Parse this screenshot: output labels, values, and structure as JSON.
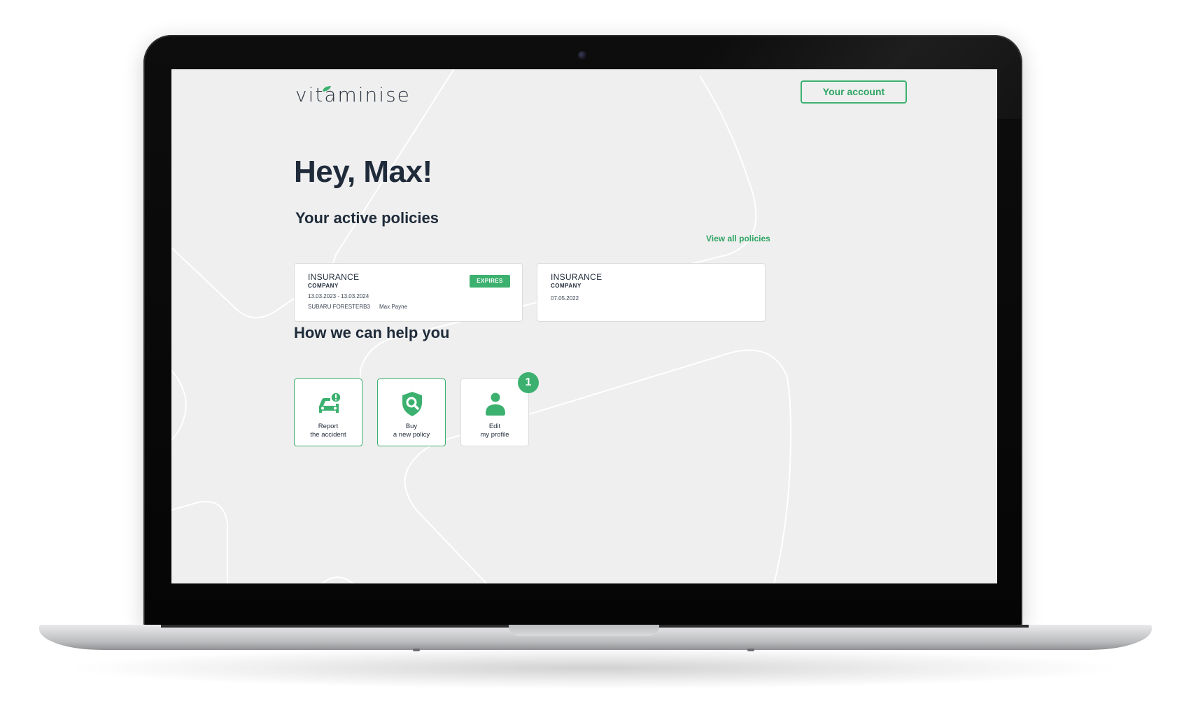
{
  "app": {
    "logo": "vitaminise",
    "account_button": "Your account"
  },
  "greeting": "Hey, Max!",
  "policies": {
    "title": "Your active policies",
    "view_all": "View all policies",
    "cards": [
      {
        "title": "INSURANCE",
        "subtitle": "COMPANY",
        "dates": "13.03.2023 - 13.03.2024",
        "vehicle": "SUBARU FORESTERB3",
        "holder": "Max Payne",
        "badge": "EXPIRES"
      },
      {
        "title": "INSURANCE",
        "subtitle": "COMPANY",
        "dates": "07.05.2022"
      }
    ]
  },
  "help": {
    "title": "How we can help you",
    "items": [
      {
        "line1": "Report",
        "line2": "the accident",
        "icon": "car-alert-icon"
      },
      {
        "line1": "Buy",
        "line2": "a new policy",
        "icon": "shield-search-icon"
      },
      {
        "line1": "Edit",
        "line2": "my profile",
        "icon": "user-icon",
        "badge": "1"
      }
    ]
  },
  "colors": {
    "accent": "#3cb16f",
    "text": "#1f2b3a",
    "screen_bg": "#efefef"
  }
}
